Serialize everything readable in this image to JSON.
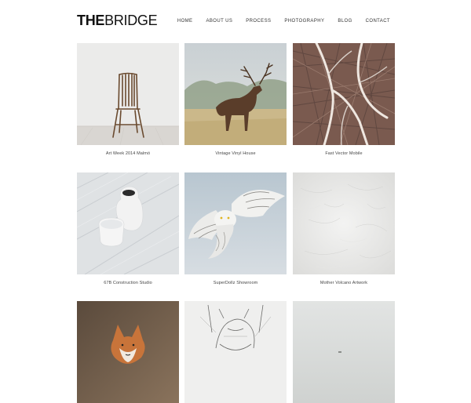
{
  "brand": {
    "logo_bold": "THE",
    "logo_light": "BRIDGE"
  },
  "nav": {
    "items": [
      "HOME",
      "ABOUT US",
      "PROCESS",
      "PHOTOGRAPHY",
      "BLOG",
      "CONTACT"
    ]
  },
  "portfolio": {
    "items": [
      {
        "caption": "Art Week 2014 Malmö",
        "image": "wooden-chair-photo"
      },
      {
        "caption": "Vintage Vinyl House",
        "image": "deer-photo"
      },
      {
        "caption": "Fast Vector Mobile",
        "image": "branches-photo"
      },
      {
        "caption": "67B Construction Studio",
        "image": "white-vases-photo"
      },
      {
        "caption": "SuperDollz Showroom",
        "image": "snowy-owl-photo"
      },
      {
        "caption": "Mother Volcano Artwork",
        "image": "white-texture-photo"
      },
      {
        "caption": "",
        "image": "fox-photo"
      },
      {
        "caption": "",
        "image": "sketch-animal-photo"
      },
      {
        "caption": "",
        "image": "misty-landscape-photo"
      }
    ]
  }
}
